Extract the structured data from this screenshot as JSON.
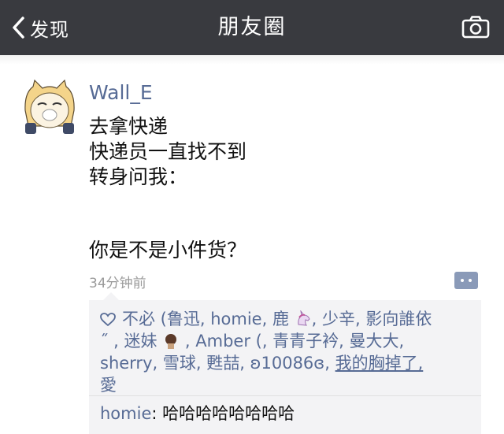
{
  "navbar": {
    "back_label": "发现",
    "title": "朋友圈",
    "bg_color": "#393a3f"
  },
  "post": {
    "author": "Wall_E",
    "lines": [
      "去拿快递",
      "快递员一直找不到",
      "转身问我：",
      "你是不是小件货？"
    ],
    "time": "34分钟前"
  },
  "likes": {
    "line1": "不必 (鲁迅, homie, 鹿",
    "line1b": ", 少辛, 影向誰依",
    "line2a": "˝ , 迷妹",
    "line2b": ", Amber (, 青青子衿, 曼大大,",
    "line3": "sherry, 雪球, 甦喆, ʚ10086ɞ, ",
    "line3_link": "我的胸掉了,",
    "line4": "愛"
  },
  "comments": [
    {
      "author": "homie",
      "text": "哈哈哈哈哈哈哈哈"
    }
  ],
  "colors": {
    "link": "#576b95",
    "comment_bg": "#f3f3f5"
  },
  "icons": [
    "chevron-left-icon",
    "camera-icon",
    "heart-icon",
    "more-icon"
  ]
}
